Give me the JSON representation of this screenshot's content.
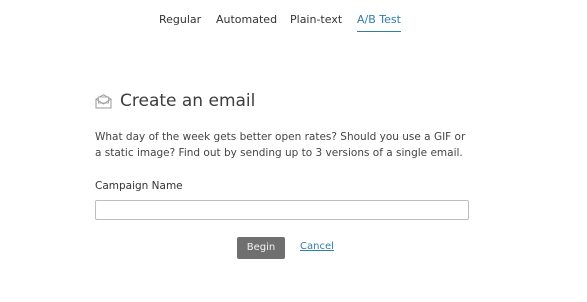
{
  "tabs": [
    {
      "label": "Regular",
      "active": false
    },
    {
      "label": "Automated",
      "active": false
    },
    {
      "label": "Plain-text",
      "active": false
    },
    {
      "label": "A/B Test",
      "active": true
    }
  ],
  "heading": {
    "icon": "envelope-icon",
    "title": "Create an email"
  },
  "description": "What day of the week gets better open rates? Should you use a GIF or a static image? Find out by sending up to 3 versions of a single email.",
  "form": {
    "campaign_name_label": "Campaign Name",
    "campaign_name_value": "",
    "campaign_name_placeholder": ""
  },
  "actions": {
    "begin_label": "Begin",
    "cancel_label": "Cancel"
  },
  "colors": {
    "accent": "#2f7fa6",
    "button_bg": "#6f6f6f"
  }
}
